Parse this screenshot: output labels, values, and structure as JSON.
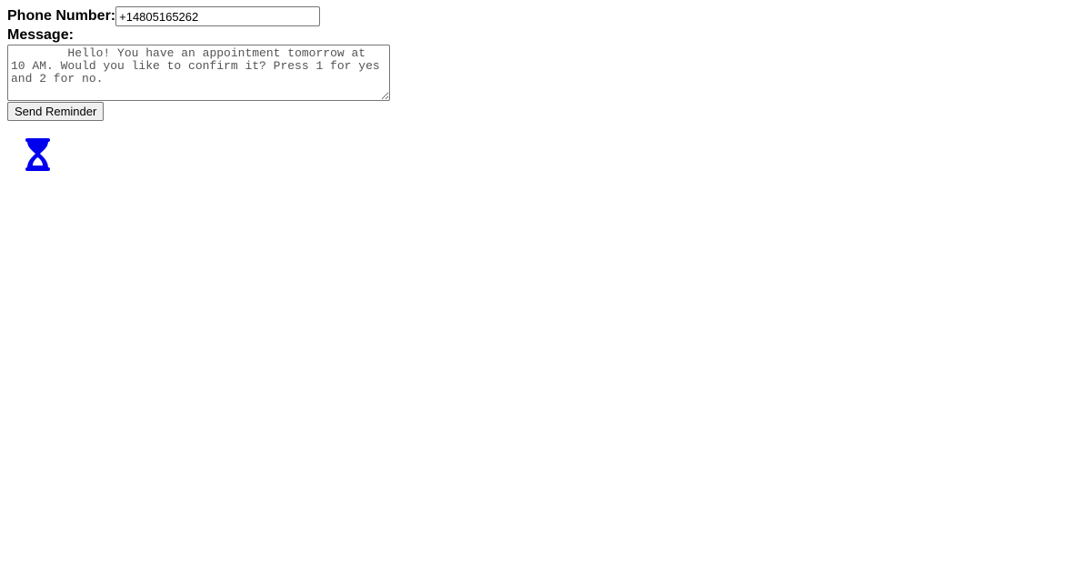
{
  "form": {
    "phone_label": "Phone Number:",
    "phone_value": "+14805165262",
    "message_label": "Message:",
    "message_value": "        Hello! You have an appointment tomorrow at 10 AM. Would you like to confirm it? Press 1 for yes and 2 for no.",
    "send_label": "Send Reminder"
  },
  "status": {
    "icon": "hourglass-icon",
    "color": "#0000ee"
  }
}
